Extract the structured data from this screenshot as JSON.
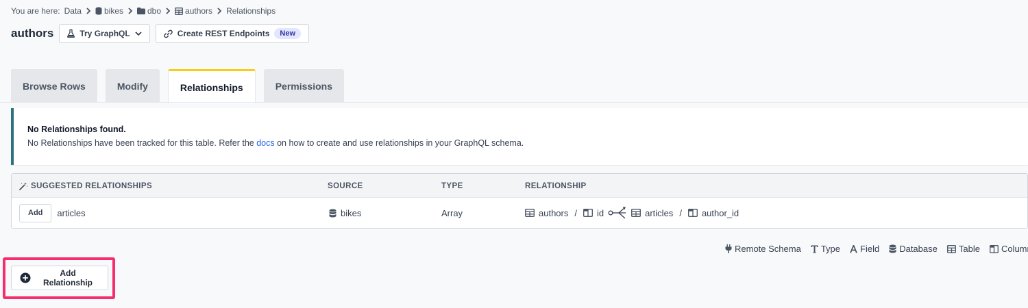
{
  "breadcrumb": {
    "prefix": "You are here:",
    "items": [
      {
        "label": "Data",
        "icon": ""
      },
      {
        "label": "bikes",
        "icon": "database-icon"
      },
      {
        "label": "dbo",
        "icon": "folder-icon"
      },
      {
        "label": "authors",
        "icon": "table-icon"
      },
      {
        "label": "Relationships",
        "icon": ""
      }
    ]
  },
  "header": {
    "title": "authors",
    "graphql_button": "Try GraphQL",
    "rest_button": "Create REST Endpoints",
    "rest_badge": "New"
  },
  "tabs": [
    {
      "label": "Browse Rows",
      "active": false
    },
    {
      "label": "Modify",
      "active": false
    },
    {
      "label": "Relationships",
      "active": true
    },
    {
      "label": "Permissions",
      "active": false
    }
  ],
  "alert": {
    "title": "No Relationships found.",
    "msg_before": "No Relationships have been tracked for this table. Refer the ",
    "msg_link": "docs",
    "msg_after": " on how to create and use relationships in your GraphQL schema."
  },
  "suggested": {
    "columns": [
      "SUGGESTED RELATIONSHIPS",
      "SOURCE",
      "TYPE",
      "RELATIONSHIP"
    ],
    "rows": [
      {
        "add_label": "Add",
        "name": "articles",
        "source": "bikes",
        "type": "Array",
        "from_table": "authors",
        "from_column": "id",
        "to_table": "articles",
        "to_column": "author_id"
      }
    ]
  },
  "legend": [
    "Remote Schema",
    "Type",
    "Field",
    "Database",
    "Table",
    "Column"
  ],
  "add_relationship_label": "Add Relationship",
  "colors": {
    "accent_tab": "#facc15",
    "alert_border": "#2e7180",
    "highlight": "#f72e6e",
    "link": "#2563eb"
  }
}
